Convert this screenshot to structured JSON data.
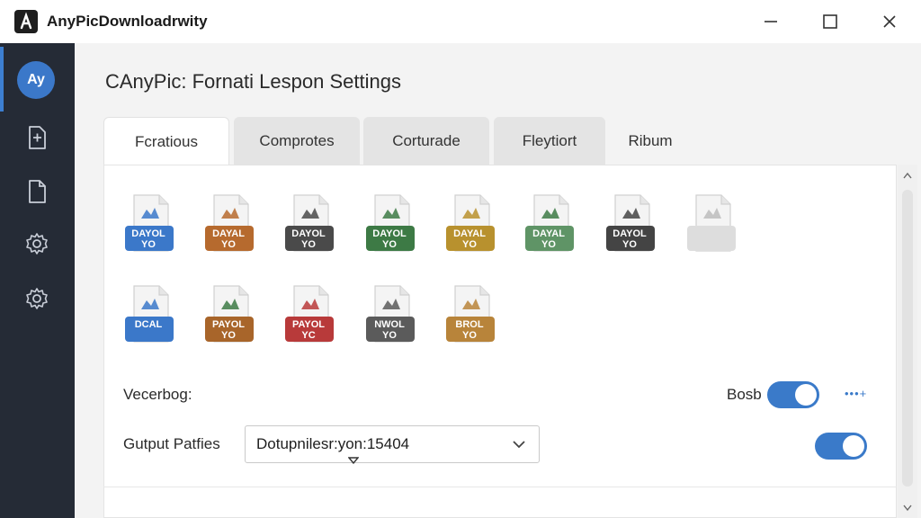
{
  "app": {
    "title": "AnyPicDownloadrwity",
    "icon_letter": "A"
  },
  "window_controls": [
    "minimize-icon",
    "maximize-icon",
    "close-icon"
  ],
  "sidebar": {
    "avatar_text": "Ay",
    "items": [
      {
        "icon": "add-file-icon"
      },
      {
        "icon": "file-icon"
      },
      {
        "icon": "gear-icon"
      },
      {
        "icon": "gear-icon"
      }
    ]
  },
  "page_title": "CAnyPic: Fornati Lespon Settings",
  "tabs": [
    {
      "label": "Fcratious",
      "active": true
    },
    {
      "label": "Comprotes"
    },
    {
      "label": "Corturade"
    },
    {
      "label": "Fleytiort"
    },
    {
      "label": "Ribum"
    }
  ],
  "formats_row1": [
    {
      "line1": "DAYOL",
      "line2": "YO",
      "color": "#3b78c9",
      "icon_color": "#3b78c9"
    },
    {
      "line1": "DAYAL",
      "line2": "YO",
      "color": "#b66a2e",
      "icon_color": "#b66a2e"
    },
    {
      "line1": "DAYOL",
      "line2": "YO",
      "color": "#4a4a4a",
      "icon_color": "#4a4a4a"
    },
    {
      "line1": "DAYOL",
      "line2": "YO",
      "color": "#3d7a45",
      "icon_color": "#3d7a45"
    },
    {
      "line1": "DAYAL",
      "line2": "YO",
      "color": "#b8912e",
      "icon_color": "#b8912e"
    },
    {
      "line1": "DAYAL",
      "line2": "YO",
      "color": "#5f9466",
      "icon_color": "#3d7a45"
    },
    {
      "line1": "DAYOL",
      "line2": "YO",
      "color": "#444444",
      "icon_color": "#444444"
    },
    {
      "line1": "",
      "line2": "",
      "color": "#dddddd",
      "icon_color": "#bcbcbc"
    }
  ],
  "formats_row2": [
    {
      "line1": "DCAL",
      "line2": "",
      "color": "#3b78c9",
      "icon_color": "#3b78c9"
    },
    {
      "line1": "PAYOL",
      "line2": "YO",
      "color": "#a8652a",
      "icon_color": "#3d7a45"
    },
    {
      "line1": "PAYOL",
      "line2": "YC",
      "color": "#b83a3a",
      "icon_color": "#b83a3a"
    },
    {
      "line1": "NWOL",
      "line2": "YO",
      "color": "#5b5b5b",
      "icon_color": "#5b5b5b"
    },
    {
      "line1": "BROL",
      "line2": "YO",
      "color": "#b8843a",
      "icon_color": "#b8843a"
    }
  ],
  "verbose": {
    "label": "Vecerbog:",
    "right_label": "Bosb",
    "enabled": true,
    "more": "•••+"
  },
  "output": {
    "label": "Gutput Patfies",
    "value": "Dotupnilesr:yon:15404",
    "enabled": true
  }
}
